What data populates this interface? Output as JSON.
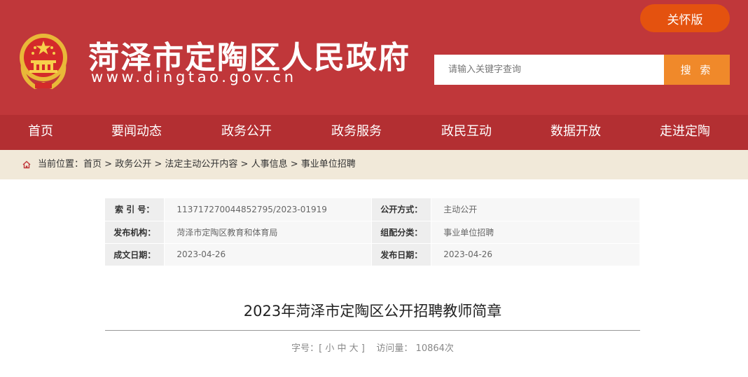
{
  "header": {
    "title": "菏泽市定陶区人民政府",
    "url": "www.dingtao.gov.cn",
    "care_mode_label": "关怀版",
    "search_placeholder": "请输入关键字查询",
    "search_button": "搜 索",
    "colors": {
      "header_bg": "#c0373a",
      "nav_bg": "#b32f32",
      "care_btn": "#e4520f",
      "search_btn": "#f0892a"
    }
  },
  "nav": {
    "items": [
      "首页",
      "要闻动态",
      "政务公开",
      "政务服务",
      "政民互动",
      "数据开放",
      "走进定陶"
    ]
  },
  "breadcrumb": {
    "prefix": "当前位置：",
    "items": [
      "首页",
      "政务公开",
      "法定主动公开内容",
      "人事信息",
      "事业单位招聘"
    ],
    "separator": " > "
  },
  "info": {
    "index_label": "索 引 号：",
    "index_value": "113717270044852795/2023-01919",
    "public_mode_label": "公开方式：",
    "public_mode_value": "主动公开",
    "publisher_label": "发布机构：",
    "publisher_value": "菏泽市定陶区教育和体育局",
    "category_label": "组配分类：",
    "category_value": "事业单位招聘",
    "created_label": "成文日期：",
    "created_value": "2023-04-26",
    "published_label": "发布日期：",
    "published_value": "2023-04-26"
  },
  "article": {
    "title": "2023年菏泽市定陶区公开招聘教师简章",
    "font_size_label": "字号：[",
    "font_small": "小",
    "font_medium": "中",
    "font_large": "大",
    "font_size_end": "]",
    "visits_label": "访问量：",
    "visits_value": "10864次"
  }
}
